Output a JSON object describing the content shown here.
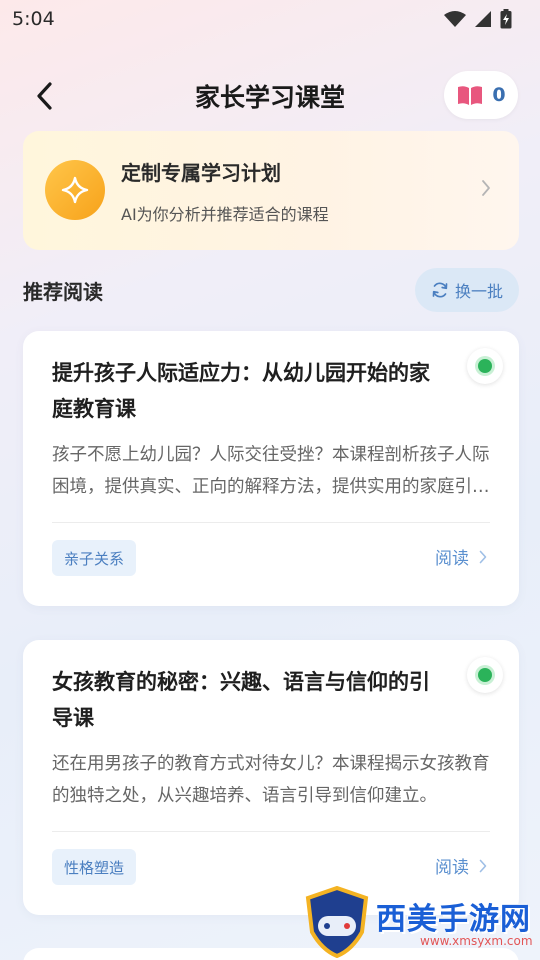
{
  "status_bar": {
    "time": "5:04",
    "icons": [
      "wifi-icon",
      "signal-icon",
      "battery-charging-icon"
    ]
  },
  "header": {
    "title": "家长学习课堂",
    "book_count": "0"
  },
  "ai_banner": {
    "title": "定制专属学习计划",
    "subtitle": "AI为你分析并推荐适合的课程"
  },
  "section": {
    "title": "推荐阅读",
    "refresh_label": "换一批"
  },
  "cards": [
    {
      "title": "提升孩子人际适应力：从幼儿园开始的家庭教育课",
      "description": "孩子不愿上幼儿园？人际交往受挫？本课程剖析孩子人际困境，提供真实、正向的解释方法，提供实用的家庭引导策略。",
      "tag": "亲子关系",
      "action": "阅读"
    },
    {
      "title": "女孩教育的秘密：兴趣、语言与信仰的引导课",
      "description": "还在用男孩子的教育方式对待女儿？本课程揭示女孩教育的独特之处，从兴趣培养、语言引导到信仰建立。",
      "tag": "性格塑造",
      "action": "阅读"
    }
  ],
  "watermark": {
    "brand": "西美手游网",
    "url": "www.xmsyxm.com"
  },
  "colors": {
    "accent_blue": "#4b7fc0",
    "badge_green": "#2bb35a",
    "ai_gold": "#f7a21a"
  }
}
